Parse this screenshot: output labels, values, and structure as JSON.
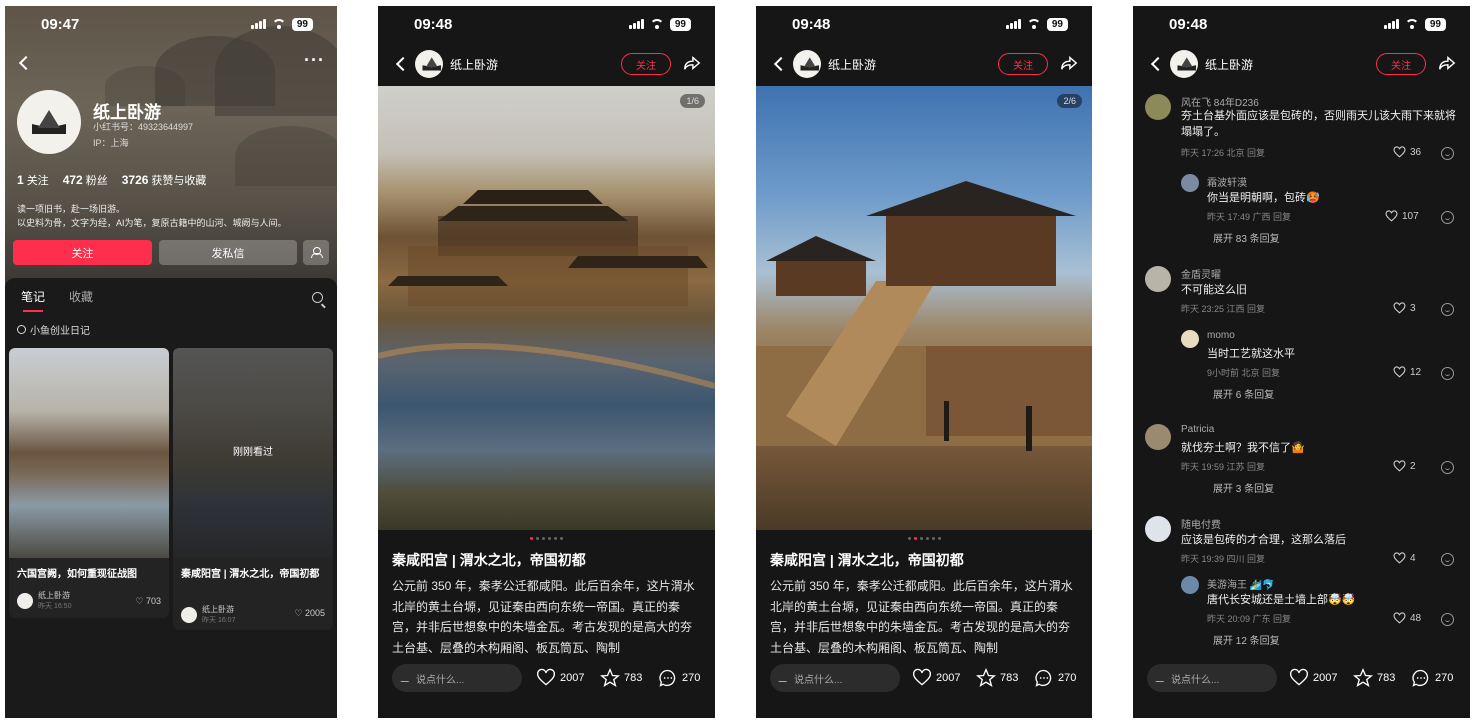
{
  "profile": {
    "time": "09:47",
    "battery": "99",
    "name": "纸上卧游",
    "id_line": "小红书号：49323644997",
    "ip_line": "IP：上海",
    "stats": [
      {
        "num": "1",
        "label": "关注"
      },
      {
        "num": "472",
        "label": "粉丝"
      },
      {
        "num": "3726",
        "label": "获赞与收藏"
      }
    ],
    "bio_line1": "读一项旧书，赴一场旧游。",
    "bio_line2": "以史料为骨，文字为经，AI为笔，复原古籍中的山河、城阙与人间。",
    "follow": "关注",
    "message": "发私信",
    "tab_notes": "笔记",
    "tab_collect": "收藏",
    "collection": "小鱼创业日记",
    "cards": [
      {
        "title": "六国宫阙，如何重现征战图",
        "author": "纸上卧游",
        "date": "昨天 16:50",
        "likes": "703"
      },
      {
        "title": "秦咸阳宫 | 渭水之北，帝国初都",
        "author": "纸上卧游",
        "date": "昨天 16:07",
        "likes": "2005",
        "overlay": "刚刚看过"
      }
    ]
  },
  "post1": {
    "time": "09:48",
    "battery": "99",
    "author": "纸上卧游",
    "follow": "关注",
    "pager": "1/6",
    "title": "秦咸阳宫 | 渭水之北，帝国初都",
    "body": "公元前 350 年，秦孝公迁都咸阳。此后百余年，这片渭水北岸的黄土台塬，见证秦由西向东统一帝国。真正的秦宫，并非后世想象中的朱墙金瓦。考古发现的是高大的夯土台基、层叠的木构厢阁、板瓦筒瓦、陶制",
    "say": "说点什么...",
    "likes": "2007",
    "stars": "783",
    "comments": "270"
  },
  "post2": {
    "time": "09:48",
    "battery": "99",
    "author": "纸上卧游",
    "follow": "关注",
    "pager": "2/6",
    "title": "秦咸阳宫 | 渭水之北，帝国初都",
    "body": "公元前 350 年，秦孝公迁都咸阳。此后百余年，这片渭水北岸的黄土台塬，见证秦由西向东统一帝国。真正的秦宫，并非后世想象中的朱墙金瓦。考古发现的是高大的夯土台基、层叠的木构厢阁、板瓦筒瓦、陶制",
    "say": "说点什么...",
    "likes": "2007",
    "stars": "783",
    "comments": "270"
  },
  "comments": {
    "time": "09:48",
    "battery": "99",
    "author": "纸上卧游",
    "follow": "关注",
    "say": "说点什么...",
    "likes": "2007",
    "stars": "783",
    "comments_count": "270",
    "items": [
      {
        "name": "风在飞 84年D236",
        "text1": "夯土台基外面应该是包砖的，否则雨天儿该大雨下来就将",
        "text2": "塌塌了。",
        "meta": "昨天 17:26 北京  回复",
        "likes": "36"
      },
      {
        "name": "霜波轩漠",
        "text1": "你当是明朝啊，包砖🥵",
        "meta": "昨天 17:49 广西  回复",
        "likes": "107",
        "expand": "展开 83 条回复"
      },
      {
        "name": "金盾灵曜",
        "text1": "不可能这么旧",
        "meta": "昨天 23:25 江西  回复",
        "likes": "3"
      },
      {
        "name": "momo",
        "text1": "当时工艺就这水平",
        "meta": "9小时前 北京  回复",
        "likes": "12",
        "expand": "展开 6 条回复"
      },
      {
        "name": "Patricia",
        "text1": "就伐夯土啊？我不信了🤷",
        "meta": "昨天 19:59 江苏  回复",
        "likes": "2",
        "expand": "展开 3 条回复"
      },
      {
        "name": "随电付费",
        "text1": "应该是包砖的才合理，这那么落后",
        "meta": "昨天 19:39 四川  回复",
        "likes": "4"
      },
      {
        "name": "美游海王 🏄‍♂️🐬",
        "text1": "唐代长安城还是土墙上部🤯🤯",
        "meta": "昨天 20:09 广东  回复",
        "likes": "48",
        "expand": "展开 12 条回复"
      }
    ]
  }
}
